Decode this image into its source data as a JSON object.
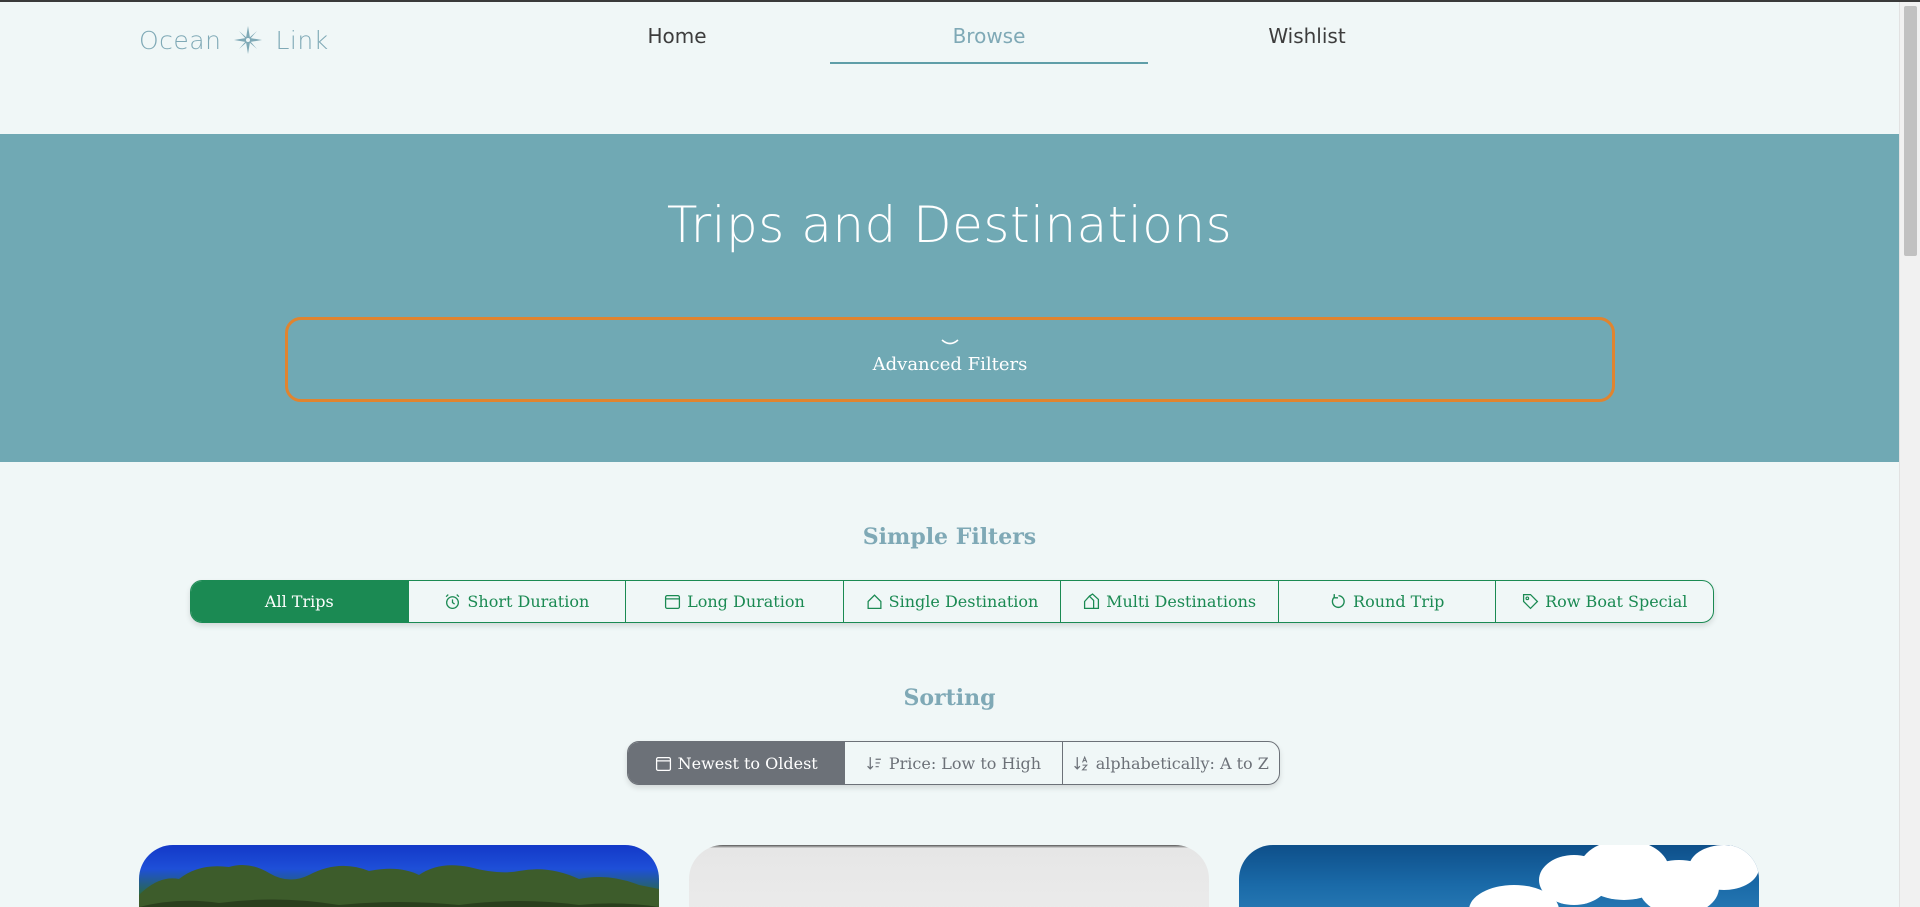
{
  "brand": {
    "name_left": "Ocean",
    "name_right": "Link",
    "icon": "compass-rose-icon"
  },
  "nav": {
    "items": [
      {
        "label": "Home"
      },
      {
        "label": "Browse",
        "active": true
      },
      {
        "label": "Wishlist"
      }
    ]
  },
  "hero": {
    "title": "Trips and Destinations",
    "advanced_filters_label": "Advanced Filters",
    "advanced_filters_icon": "chevron-down-icon"
  },
  "simple_filters": {
    "heading": "Simple Filters",
    "items": [
      {
        "label": "All Trips",
        "icon": "",
        "active": true
      },
      {
        "label": "Short Duration",
        "icon": "alarm-clock-icon"
      },
      {
        "label": "Long Duration",
        "icon": "calendar-icon"
      },
      {
        "label": "Single Destination",
        "icon": "house-icon"
      },
      {
        "label": "Multi Destinations",
        "icon": "houses-icon"
      },
      {
        "label": "Round Trip",
        "icon": "rotate-icon"
      },
      {
        "label": "Row Boat Special",
        "icon": "tag-icon"
      }
    ]
  },
  "sorting": {
    "heading": "Sorting",
    "items": [
      {
        "label": "Newest to Oldest",
        "icon": "calendar-icon",
        "active": true
      },
      {
        "label": "Price: Low to High",
        "icon": "sort-numeric-down-icon"
      },
      {
        "label": "alphabetically: A to Z",
        "icon": "sort-alpha-down-icon"
      }
    ]
  },
  "colors": {
    "accent_teal": "#70a9b4",
    "brand_green": "#1b8a53",
    "focus_orange": "#e0842f",
    "sort_gray": "#6c7178",
    "page_bg": "#f0f7f7"
  }
}
